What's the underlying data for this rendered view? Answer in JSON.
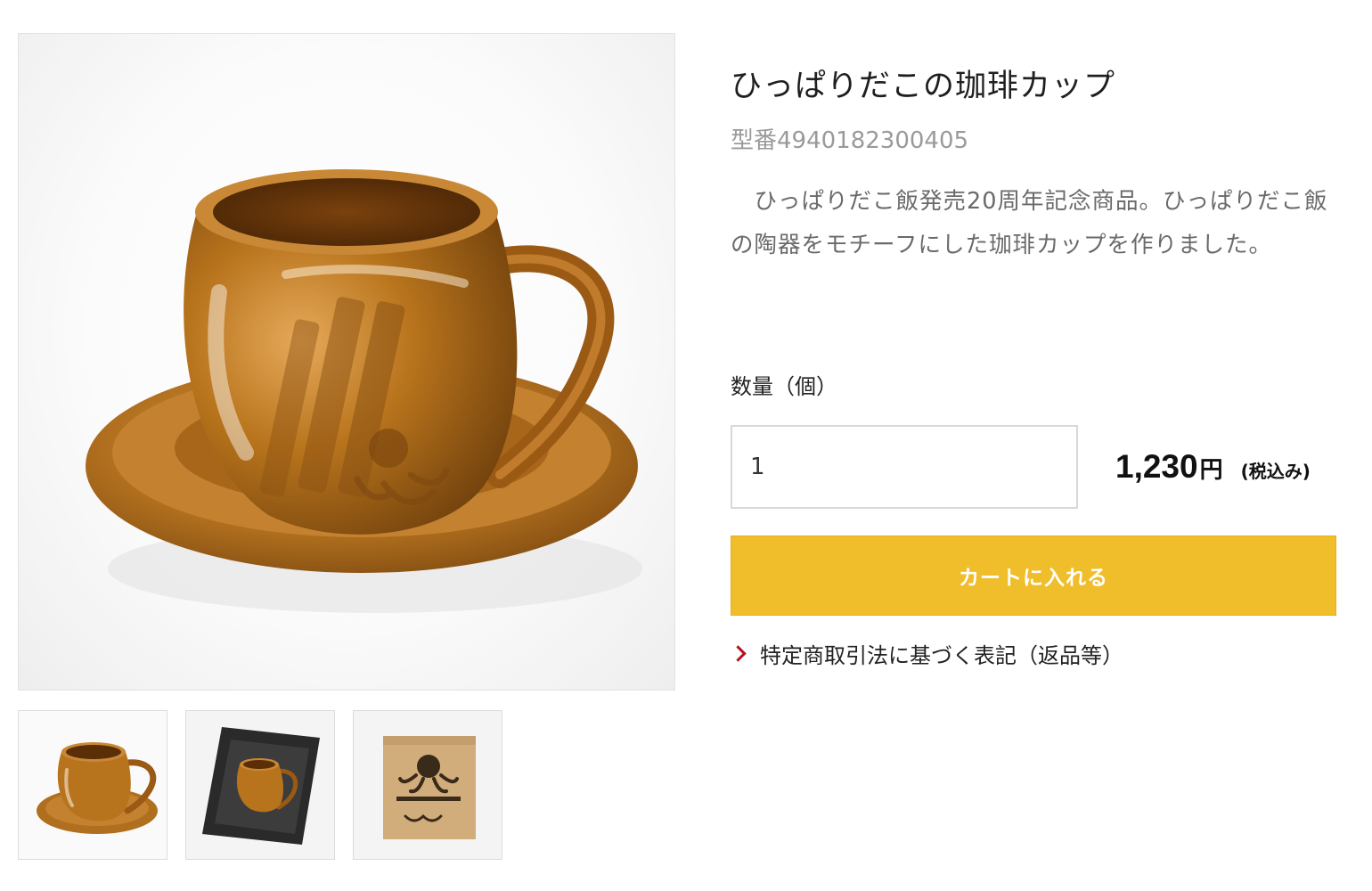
{
  "product": {
    "title": "ひっぱりだこの珈琲カップ",
    "model": "型番4940182300405",
    "description": "　ひっぱりだこ飯発売20周年記念商品。ひっぱりだこ飯の陶器をモチーフにした珈琲カップを作りました。"
  },
  "purchase": {
    "quantity_label": "数量（個）",
    "quantity_value": "1",
    "price": "1,230",
    "price_unit": "円",
    "tax_note": "(税込み)",
    "cart_button_label": "カートに入れる"
  },
  "links": {
    "legal_notice": "特定商取引法に基づく表記（返品等）"
  },
  "gallery": {
    "main_image": "coffee-cup-with-saucer-photo",
    "thumbnails": [
      "cup-and-saucer-thumbnail",
      "cup-in-gift-box-thumbnail",
      "kraft-package-box-thumbnail"
    ]
  },
  "colors": {
    "accent": "#f0bd2b",
    "link_chevron": "#b5121b",
    "glaze": "#b8741c"
  }
}
